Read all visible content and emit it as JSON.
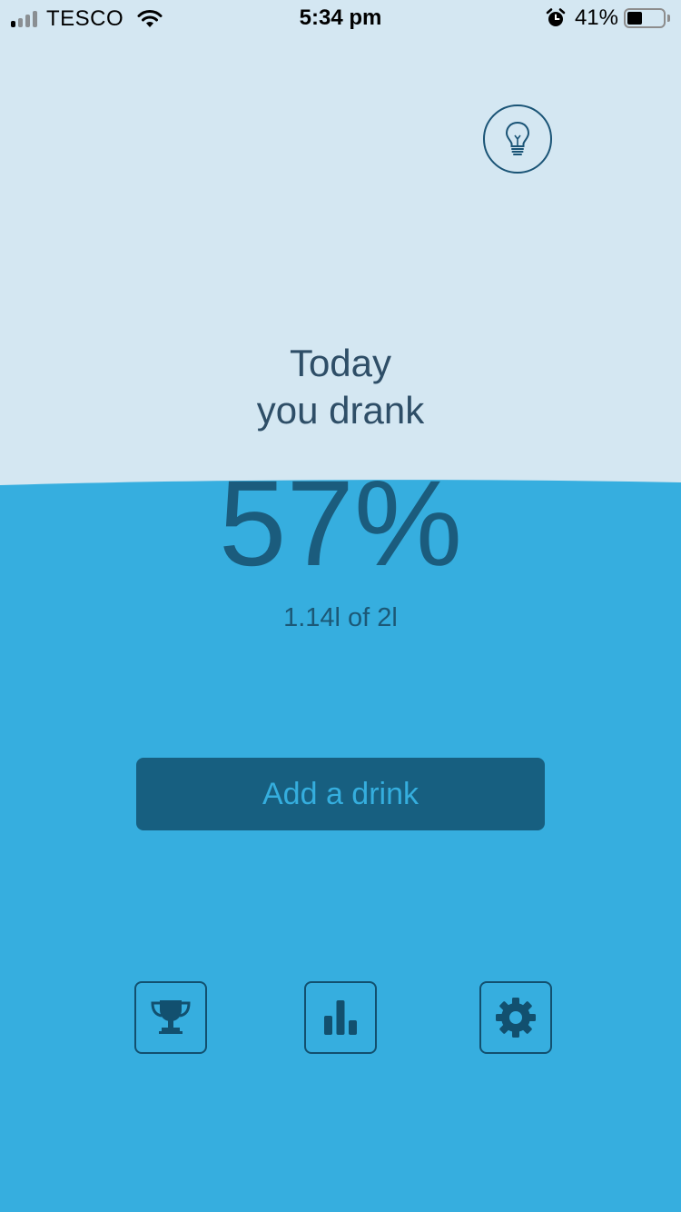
{
  "status_bar": {
    "carrier": "TESCO",
    "time": "5:34 pm",
    "battery_percent": "41%",
    "battery_level": 0.41,
    "signal_bars_active": 1,
    "signal_bars_total": 4
  },
  "hydration": {
    "heading_line1": "Today",
    "heading_line2": "you drank",
    "percent": "57%",
    "amount": "1.14l of 2l",
    "fill_level": 0.57
  },
  "actions": {
    "add_drink_label": "Add a drink"
  },
  "icons": {
    "tip": "lightbulb-icon",
    "achievements": "trophy-icon",
    "statistics": "bar-chart-icon",
    "settings": "gear-icon"
  },
  "colors": {
    "sky": "#d4e7f2",
    "water": "#36aedf",
    "dark_accent": "#175f80",
    "text_dark": "#2e4e67",
    "button_text": "#35aede"
  }
}
